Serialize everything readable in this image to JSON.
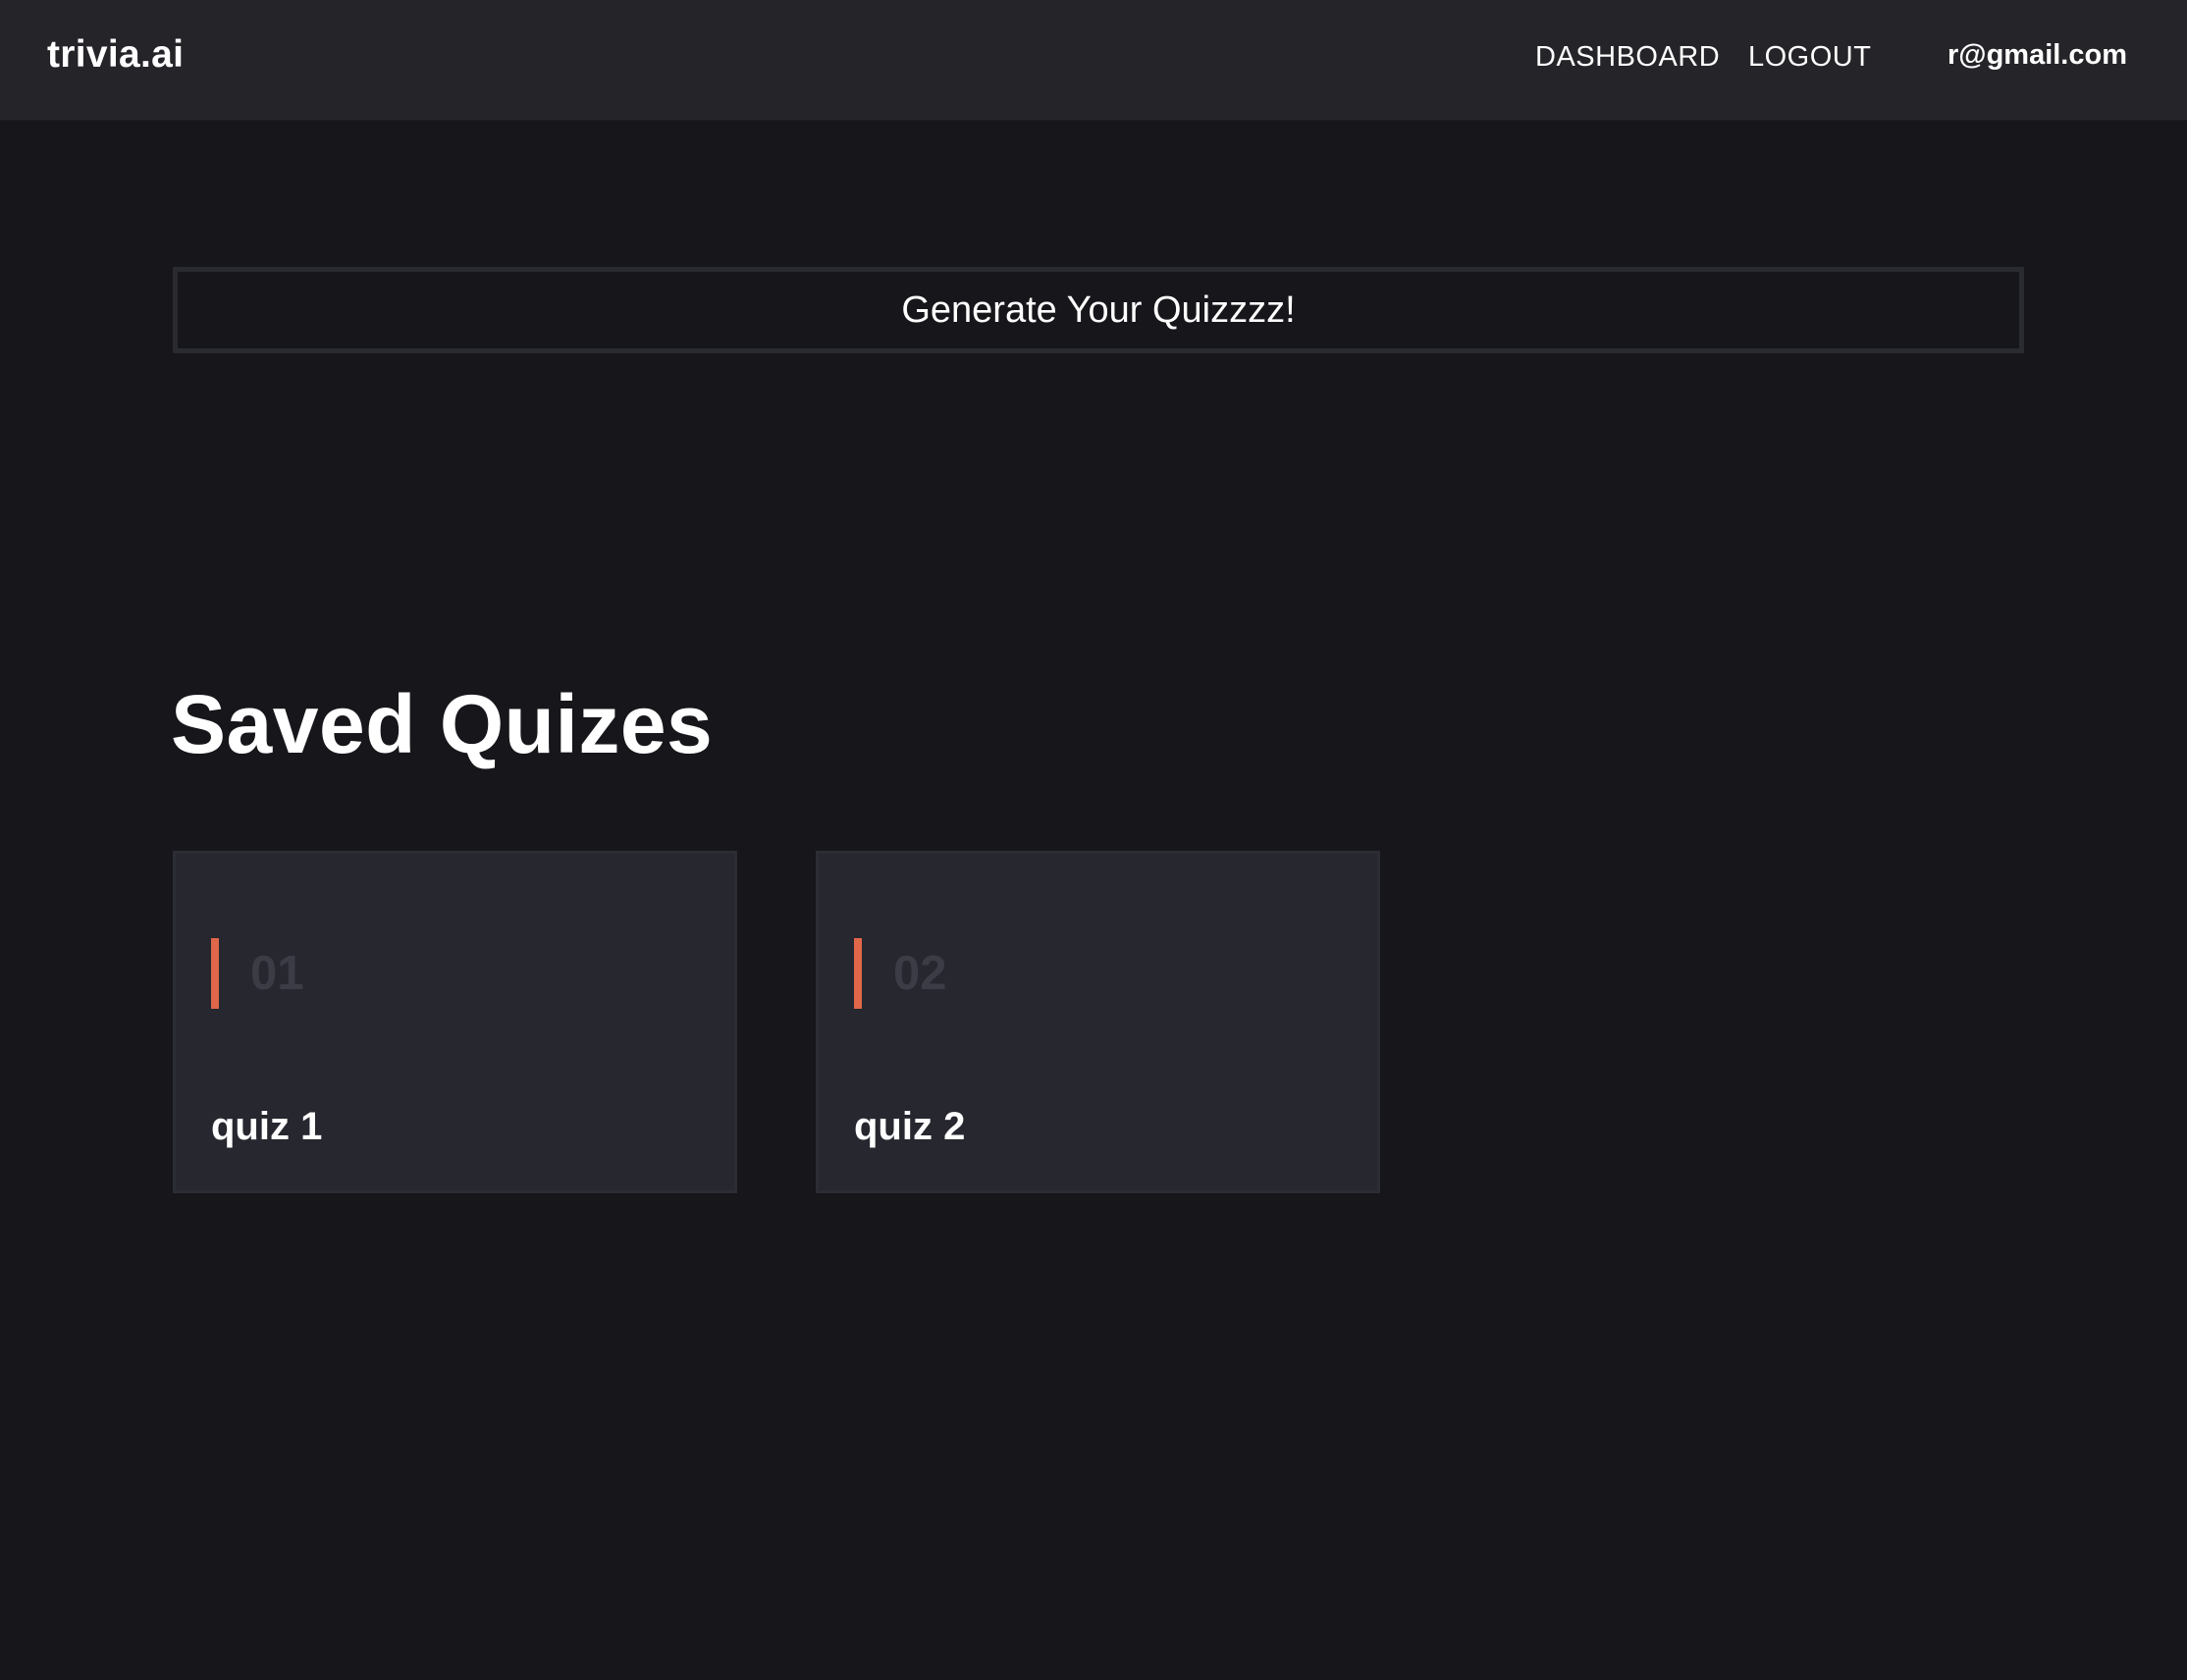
{
  "navbar": {
    "brand": "trivia.ai",
    "links": [
      {
        "label": "DASHBOARD"
      },
      {
        "label": "LOGOUT"
      }
    ],
    "user_email": "r@gmail.com"
  },
  "main": {
    "generate_button_label": "Generate Your Quizzzz!",
    "saved_section_title": "Saved Quizes",
    "quizzes": [
      {
        "number": "01",
        "title": "quiz 1"
      },
      {
        "number": "02",
        "title": "quiz 2"
      }
    ]
  },
  "colors": {
    "background": "#16161b",
    "navbar": "#242429",
    "card": "#26272f",
    "accent": "#e1674a",
    "number_text": "#3b3c45"
  }
}
